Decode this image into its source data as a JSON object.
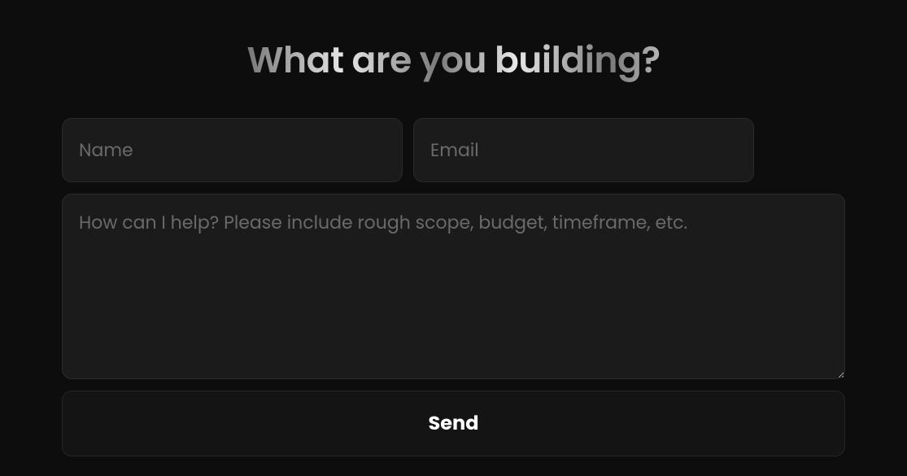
{
  "heading": "What are you building?",
  "form": {
    "name": {
      "placeholder": "Name",
      "value": ""
    },
    "email": {
      "placeholder": "Email",
      "value": ""
    },
    "message": {
      "placeholder": "How can I help? Please include rough scope, budget, timeframe, etc.",
      "value": ""
    },
    "submit_label": "Send"
  }
}
